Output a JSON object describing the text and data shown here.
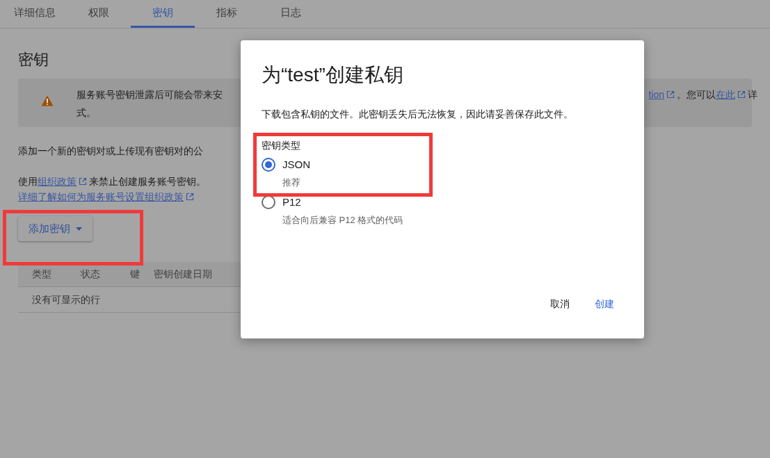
{
  "tabs": [
    {
      "label": "详细信息",
      "selected": false
    },
    {
      "label": "权限",
      "selected": false
    },
    {
      "label": "密钥",
      "selected": true
    },
    {
      "label": "指标",
      "selected": false
    },
    {
      "label": "日志",
      "selected": false
    }
  ],
  "section_title": "密钥",
  "alert": {
    "line1_start": "服务账号密钥泄露后可能会带来安",
    "link1": "tion",
    "text_mid": "。您可以",
    "link2": "在此",
    "text_end": "详",
    "line2": "式。"
  },
  "intro": "添加一个新的密钥对或上传现有密钥对的公",
  "policy": {
    "prefix": "使用",
    "link": "组织政策",
    "suffix": "来禁止创建服务账号密钥。",
    "learn_link": "详细了解如何为服务账号设置组织政策"
  },
  "add_key_button": {
    "label": "添加密钥",
    "highlighted": true
  },
  "table": {
    "columns": [
      "类型",
      "状态",
      "键",
      "密钥创建日期"
    ],
    "empty_text": "没有可显示的行"
  },
  "dialog": {
    "title": "为“test”创建私钥",
    "description": "下载包含私钥的文件。此密钥丢失后无法恢复，因此请妥善保存此文件。",
    "group_label": "密钥类型",
    "group_highlighted": true,
    "options": [
      {
        "label": "JSON",
        "hint": "推荐",
        "selected": true
      },
      {
        "label": "P12",
        "hint": "适合向后兼容 P12 格式的代码",
        "selected": false
      }
    ],
    "buttons": [
      {
        "label": "取消",
        "kind": "text"
      },
      {
        "label": "创建",
        "kind": "primary"
      }
    ]
  }
}
